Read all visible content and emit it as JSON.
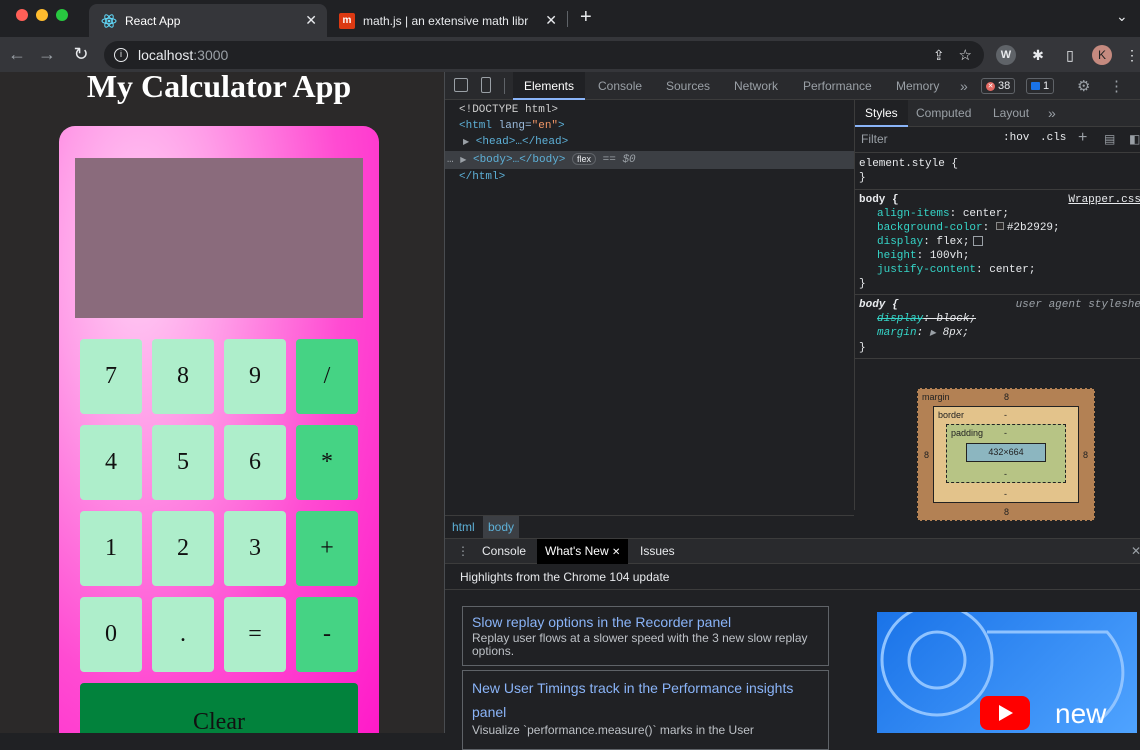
{
  "browser": {
    "tabs": [
      {
        "title": "React App",
        "active": true,
        "icon": "react-icon"
      },
      {
        "title": "math.js | an extensive math libr",
        "active": false,
        "icon": "mathjs-icon"
      }
    ],
    "new_tab": "+",
    "address": {
      "host": "localhost",
      "port": ":3000"
    },
    "profile_initial": "K",
    "extension_initial": "W"
  },
  "app": {
    "title": "My Calculator App",
    "keys": [
      {
        "label": "7",
        "op": false
      },
      {
        "label": "8",
        "op": false
      },
      {
        "label": "9",
        "op": false
      },
      {
        "label": "/",
        "op": true
      },
      {
        "label": "4",
        "op": false
      },
      {
        "label": "5",
        "op": false
      },
      {
        "label": "6",
        "op": false
      },
      {
        "label": "*",
        "op": true
      },
      {
        "label": "1",
        "op": false
      },
      {
        "label": "2",
        "op": false
      },
      {
        "label": "3",
        "op": false
      },
      {
        "label": "+",
        "op": true
      },
      {
        "label": "0",
        "op": false
      },
      {
        "label": ".",
        "op": false
      },
      {
        "label": "=",
        "op": false
      },
      {
        "label": "-",
        "op": true
      }
    ],
    "clear": "Clear"
  },
  "devtools": {
    "tabs": [
      "Elements",
      "Console",
      "Sources",
      "Network",
      "Performance",
      "Memory"
    ],
    "more": "»",
    "error_count": "38",
    "message_count": "1",
    "dom": {
      "doctype": "<!DOCTYPE html>",
      "html_open": "<html",
      "lang_attr": " lang=",
      "lang_val": "\"en\"",
      "head": "<head>…</head>",
      "body": "<body>…</body>",
      "flex_badge": "flex",
      "dollar0": "== $0",
      "html_close": "</html>"
    },
    "styles": {
      "tabs": [
        "Styles",
        "Computed",
        "Layout"
      ],
      "filter_placeholder": "Filter",
      "hov": ":hov",
      "cls": ".cls",
      "element_style": "element.style {",
      "close_brace": "}",
      "rule1": {
        "selector": "body {",
        "source": "Wrapper.css",
        "decls": [
          {
            "prop": "align-items",
            "value": "center;"
          },
          {
            "prop": "background-color",
            "value": "#2b2929;"
          },
          {
            "prop": "display",
            "value": "flex;"
          },
          {
            "prop": "height",
            "value": "100vh;"
          },
          {
            "prop": "justify-content",
            "value": "center;"
          }
        ]
      },
      "rule2": {
        "selector": "body {",
        "source": "user agent styleshe",
        "decls": [
          {
            "prop": "display",
            "value": "block;"
          },
          {
            "prop": "margin",
            "value": "8px;"
          }
        ]
      }
    },
    "box_model": {
      "margin_label": "margin",
      "margin": "8",
      "border_label": "border",
      "border": "-",
      "padding_label": "padding",
      "padding": "-",
      "content": "432×664"
    },
    "breadcrumbs": [
      "html",
      "body"
    ],
    "drawer": {
      "tabs": [
        "Console",
        "What's New",
        "Issues"
      ],
      "heading": "Highlights from the Chrome 104 update",
      "cards": [
        {
          "title": "Slow replay options in the Recorder panel",
          "desc": "Replay user flows at a slower speed with the 3 new slow replay options."
        },
        {
          "title": "New User Timings track in the Performance insights panel",
          "desc": "Visualize `performance.measure()` marks in the User"
        }
      ],
      "video_caption": "new"
    }
  },
  "colors": {
    "app_bg": "#2b2929",
    "key": "#aeeecb",
    "op_key": "#45d384",
    "clear": "#02823c",
    "display": "#8a6b7c",
    "accent": "#8ab4f8"
  }
}
